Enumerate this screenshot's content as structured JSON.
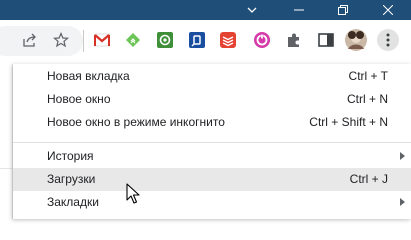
{
  "window": {
    "minimize_icon": "minimize-icon",
    "restore_icon": "restore-icon",
    "close_icon": "close-icon",
    "dropdown_icon": "chevron-down-icon"
  },
  "toolbar": {
    "share_icon": "share-icon",
    "bookmark_icon": "star-icon",
    "extensions": [
      "gmail-icon",
      "feedly-icon",
      "green-app-icon",
      "blue-app-icon",
      "todoist-icon",
      "pink-app-icon",
      "puzzle-icon",
      "sidebar-icon",
      "avatar",
      "kebab-menu-icon"
    ]
  },
  "menu": {
    "items": [
      {
        "label": "Новая вкладка",
        "shortcut": "Ctrl + T"
      },
      {
        "label": "Новое окно",
        "shortcut": "Ctrl + N"
      },
      {
        "label": "Новое окно в режиме инкогнито",
        "shortcut": "Ctrl + Shift + N"
      },
      {
        "label": "История",
        "shortcut": ""
      },
      {
        "label": "Загрузки",
        "shortcut": "Ctrl + J"
      },
      {
        "label": "Закладки",
        "shortcut": ""
      }
    ]
  },
  "colors": {
    "titlebar": "#1f4e78",
    "hover": "#e8e8e8"
  }
}
